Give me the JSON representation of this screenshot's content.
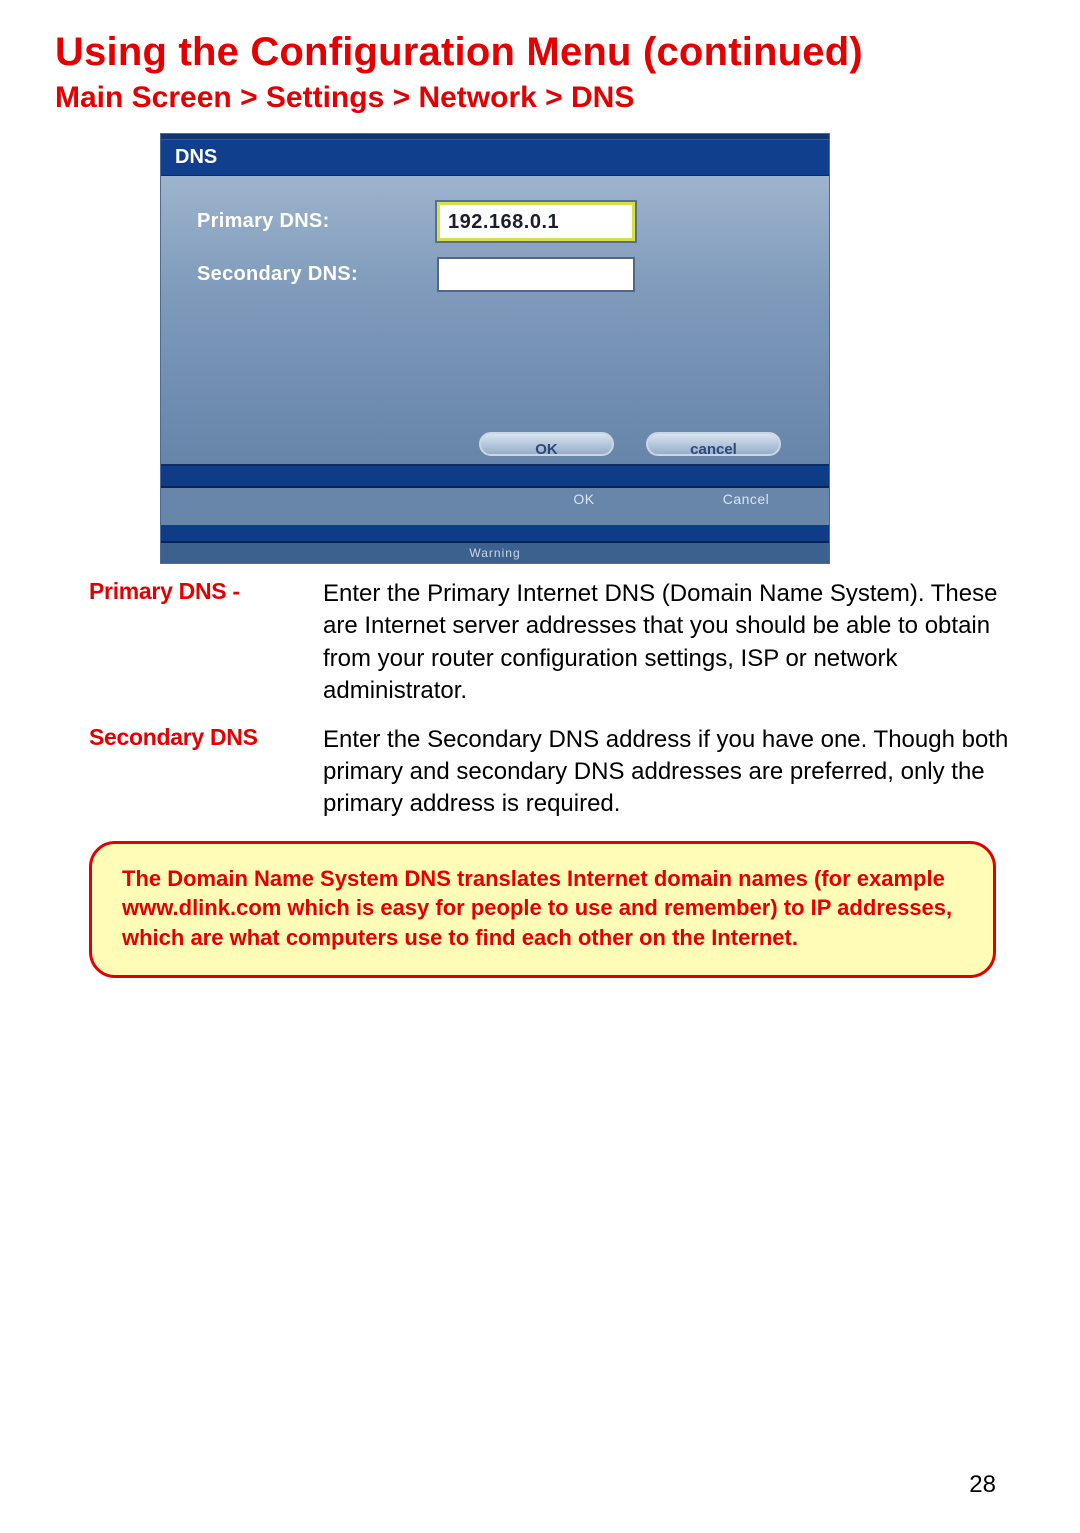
{
  "title": "Using the Configuration Menu (continued)",
  "breadcrumb": "Main Screen > Settings > Network > DNS",
  "screenshot": {
    "dialog_title": "DNS",
    "primary_label": "Primary DNS:",
    "primary_value": "192.168.0.1",
    "secondary_label": "Secondary DNS:",
    "secondary_value": "",
    "ok_button": "OK",
    "cancel_button": "cancel",
    "dup_ok": "OK",
    "dup_cancel": "Cancel",
    "warning_strip": "Warning"
  },
  "definitions": {
    "primary": {
      "label": "Primary DNS -",
      "text": "Enter the Primary Internet DNS (Domain Name System). These are Internet server addresses that you should be able to obtain from your router configuration settings, ISP or network administrator."
    },
    "secondary": {
      "label": "Secondary DNS",
      "text": "Enter the Secondary DNS address if you have one. Though both primary and secondary DNS addresses are preferred, only the primary address is required."
    }
  },
  "note": "The Domain Name System DNS translates Internet domain names (for example www.dlink.com which is easy for people to use and remember) to IP addresses, which are what computers use to find each other on the Internet.",
  "page_number": "28"
}
